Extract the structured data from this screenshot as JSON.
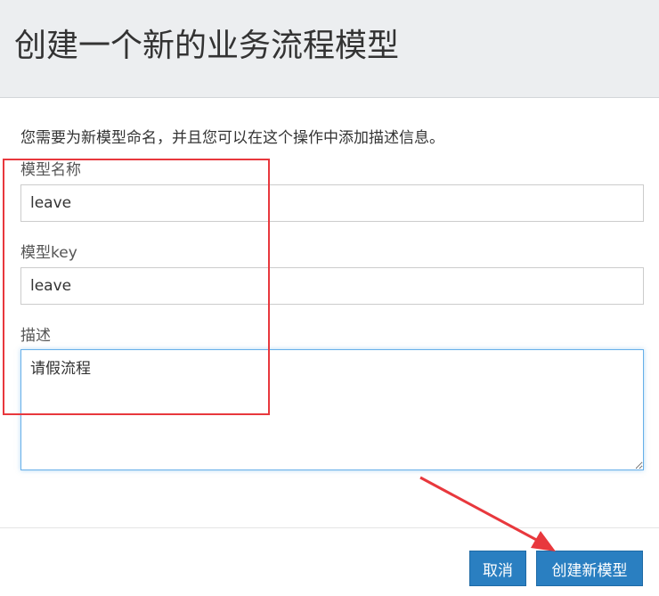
{
  "dialog": {
    "title": "创建一个新的业务流程模型",
    "description": "您需要为新模型命名，并且您可以在这个操作中添加描述信息。"
  },
  "form": {
    "name_label": "模型名称",
    "name_value": "leave",
    "key_label": "模型key",
    "key_value": "leave",
    "desc_label": "描述",
    "desc_value": "请假流程"
  },
  "buttons": {
    "cancel": "取消",
    "create": "创建新模型"
  },
  "colors": {
    "header_bg": "#eceef0",
    "button_blue": "#2a7fc1",
    "annotation_red": "#e8383d"
  }
}
